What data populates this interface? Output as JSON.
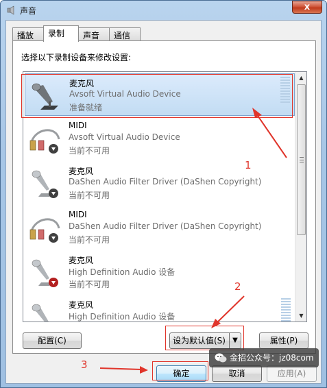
{
  "window": {
    "title": "声音",
    "close_label": "x"
  },
  "tabs": [
    {
      "label": "播放",
      "active": false
    },
    {
      "label": "录制",
      "active": true
    },
    {
      "label": "声音",
      "active": false
    },
    {
      "label": "通信",
      "active": false
    }
  ],
  "instruction": "选择以下录制设备来修改设置:",
  "devices": [
    {
      "name": "麦克风",
      "desc": "Avsoft Virtual Audio Device",
      "status": "准备就绪",
      "icon": "microphone-icon",
      "selected": true,
      "badge": "",
      "show_meter": true
    },
    {
      "name": "MIDI",
      "desc": "Avsoft Virtual Audio Device",
      "status": "当前不可用",
      "icon": "audio-cable-icon",
      "selected": false,
      "badge": "down-arrow-badge",
      "show_meter": false
    },
    {
      "name": "麦克风",
      "desc": "DaShen Audio Filter Driver (DaShen Copyright)",
      "status": "当前不可用",
      "icon": "microphone-icon",
      "selected": false,
      "badge": "down-arrow-badge",
      "show_meter": false
    },
    {
      "name": "MIDI",
      "desc": "DaShen Audio Filter Driver (DaShen Copyright)",
      "status": "当前不可用",
      "icon": "audio-cable-icon",
      "selected": false,
      "badge": "down-arrow-badge",
      "show_meter": false
    },
    {
      "name": "麦克风",
      "desc": "High Definition Audio 设备",
      "status": "当前不可用",
      "icon": "microphone-icon",
      "selected": false,
      "badge": "red-down-arrow-badge",
      "show_meter": false
    },
    {
      "name": "麦克风",
      "desc": "High Definition Audio 设备",
      "status": "",
      "icon": "microphone-icon",
      "selected": false,
      "badge": "",
      "show_meter": true
    }
  ],
  "buttons": {
    "configure": "配置(C)",
    "set_default": "设为默认值(S)",
    "properties": "属性(P)",
    "ok": "确定",
    "cancel": "取消",
    "apply": "应用(A)"
  },
  "annotations": {
    "one": "1",
    "two": "2",
    "three": "3"
  },
  "watermark": {
    "text": "金招公众号：jz08com",
    "icon": "wechat-icon"
  },
  "colors": {
    "annotation": "#e0352b",
    "selection": "#c2dcf3"
  }
}
